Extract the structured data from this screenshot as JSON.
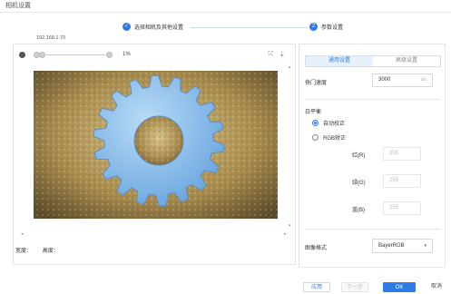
{
  "window": {
    "title": "相机设置"
  },
  "steps": [
    {
      "number": "✓",
      "label": "选择相机及其他设置"
    },
    {
      "number": "2",
      "label": "参数设置"
    }
  ],
  "camera_ip": "192.168.1.70",
  "zoom": {
    "percent": "1%"
  },
  "image_info": {
    "width_label": "宽度：",
    "height_label": "高度："
  },
  "tabs": [
    {
      "label": "通用设置",
      "active": true
    },
    {
      "label": "高级设置",
      "active": false
    }
  ],
  "exposure": {
    "label": "快门速度",
    "value": "3000",
    "unit": "us"
  },
  "white_balance": {
    "label": "白平衡",
    "options": [
      {
        "label": "自动校正",
        "selected": true
      },
      {
        "label": "RGB矫正",
        "selected": false
      }
    ],
    "red": {
      "label": "红(R)",
      "value": "255"
    },
    "green": {
      "label": "绿(G)",
      "value": "255"
    },
    "blue": {
      "label": "蓝(B)",
      "value": "255"
    }
  },
  "image_format": {
    "label": "图像格式",
    "value": "BayerRGB"
  },
  "buttons": {
    "apply": "应用",
    "next": "下一步",
    "ok": "OK",
    "cancel": "取消"
  },
  "colors": {
    "accent": "#2d7be5",
    "gear": "#7fb6ea",
    "background_texture": "#b8a060"
  }
}
